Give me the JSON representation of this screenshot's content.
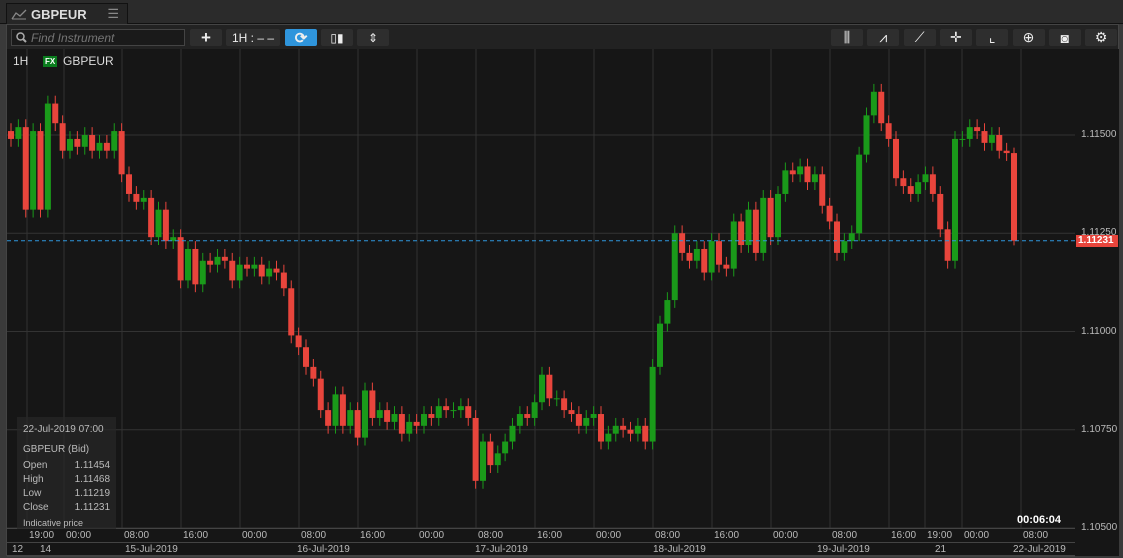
{
  "tab": {
    "icon": "line-chart-icon",
    "title": "GBPEUR",
    "menu_icon": "hamburger-menu-icon"
  },
  "toolbar": {
    "search_placeholder": "Find Instrument",
    "add": "+",
    "interval": "1H : – –",
    "refresh": "⟳",
    "layout": "▯▮",
    "resize": "⇕",
    "right_tools": [
      "indicators-icon",
      "studies-icon",
      "trendline-icon",
      "crosshair-icon",
      "curve-icon",
      "zoom-icon",
      "camera-icon",
      "gear-icon"
    ]
  },
  "legend": {
    "interval": "1H",
    "badge": "FX",
    "symbol": "GBPEUR"
  },
  "price_axis": {
    "labels": [
      "1.11500",
      "1.11250",
      "1.11000",
      "1.10750",
      "1.10500"
    ],
    "current": "1.11231"
  },
  "time_axis": {
    "hours": [
      "19:00",
      "00:00",
      "08:00",
      "16:00",
      "00:00",
      "08:00",
      "16:00",
      "00:00",
      "08:00",
      "16:00",
      "00:00",
      "08:00",
      "16:00",
      "00:00",
      "08:00",
      "16:00",
      "19:00",
      "00:00",
      "08:00"
    ],
    "dates": [
      "12",
      "14",
      "15-Jul-2019",
      "16-Jul-2019",
      "17-Jul-2019",
      "18-Jul-2019",
      "19-Jul-2019",
      "21",
      "22-Jul-2019"
    ]
  },
  "info": {
    "datetime": "22-Jul-2019 07:00",
    "title": "GBPEUR (Bid)",
    "rows": [
      {
        "k": "Open",
        "v": "1.11454"
      },
      {
        "k": "High",
        "v": "1.11468"
      },
      {
        "k": "Low",
        "v": "1.11219"
      },
      {
        "k": "Close",
        "v": "1.11231"
      }
    ],
    "note": "Indicative price"
  },
  "timer": "00:06:04",
  "colors": {
    "up": "#1a9a1a",
    "down": "#e8453c",
    "current_line": "#2f95dc",
    "accent": "#2f95dc"
  },
  "chart_data": {
    "type": "candlestick",
    "ylim": [
      1.1045,
      1.1165
    ],
    "close": [
      1.1149,
      1.1152,
      1.1131,
      1.1151,
      1.1131,
      1.1158,
      1.1153,
      1.1146,
      1.1149,
      1.1147,
      1.115,
      1.1146,
      1.1148,
      1.1146,
      1.1151,
      1.114,
      1.1135,
      1.1133,
      1.1134,
      1.1124,
      1.1131,
      1.1123,
      1.1124,
      1.1113,
      1.1121,
      1.1112,
      1.1118,
      1.1117,
      1.1119,
      1.1118,
      1.1113,
      1.1117,
      1.1116,
      1.1117,
      1.1114,
      1.1116,
      1.1115,
      1.1111,
      1.1099,
      1.1096,
      1.1091,
      1.1088,
      1.108,
      1.1076,
      1.1084,
      1.1076,
      1.108,
      1.1073,
      1.1085,
      1.1078,
      1.108,
      1.1077,
      1.1079,
      1.1074,
      1.1077,
      1.1076,
      1.1079,
      1.1078,
      1.1081,
      1.108,
      1.108,
      1.1081,
      1.1078,
      1.1062,
      1.1072,
      1.1066,
      1.1069,
      1.1072,
      1.1076,
      1.1079,
      1.1078,
      1.1082,
      1.1089,
      1.1083,
      1.1083,
      1.108,
      1.1079,
      1.1076,
      1.1078,
      1.1079,
      1.1072,
      1.1074,
      1.1076,
      1.1075,
      1.1074,
      1.1076,
      1.1072,
      1.1091,
      1.1102,
      1.1108,
      1.1125,
      1.112,
      1.1118,
      1.1121,
      1.1115,
      1.1123,
      1.1117,
      1.1116,
      1.1128,
      1.1122,
      1.1131,
      1.112,
      1.1134,
      1.1124,
      1.1135,
      1.1141,
      1.114,
      1.1142,
      1.1138,
      1.114,
      1.1132,
      1.1128,
      1.112,
      1.1123,
      1.1125,
      1.1145,
      1.1155,
      1.1161,
      1.1153,
      1.1149,
      1.1139,
      1.1137,
      1.1135,
      1.1138,
      1.114,
      1.1135,
      1.1126,
      1.1118,
      1.1149,
      1.1149,
      1.1152,
      1.1151,
      1.1148,
      1.115,
      1.1146,
      1.11454,
      1.11231
    ],
    "last": {
      "open": 1.11454,
      "high": 1.11468,
      "low": 1.11219,
      "close": 1.11231
    }
  }
}
